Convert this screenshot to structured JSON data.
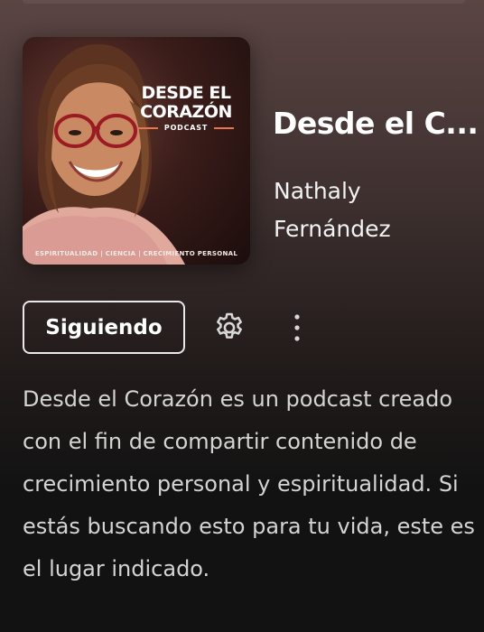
{
  "podcast": {
    "cover": {
      "title_line1": "DESDE EL",
      "title_line2": "CORAZÓN",
      "subtitle": "PODCAST",
      "footer": "ESPIRITUALIDAD | CIENCIA | CRECIMIENTO PERSONAL",
      "accent_color": "#e9744d"
    },
    "title": "Desde el C...",
    "author": "Nathaly Fernández",
    "follow_label": "Siguiendo",
    "settings_icon": "gear-icon",
    "more_icon": "more-vertical-icon",
    "description": "Desde el Corazón es un podcast creado con el fin de compartir contenido de crecimiento personal y espiritualidad. Si estás buscando esto para tu vida, este es el lugar indicado."
  },
  "colors": {
    "background_top": "#5a4543",
    "background_bottom": "#121212",
    "text_primary": "#ffffff",
    "text_secondary": "#d4d4d4"
  }
}
